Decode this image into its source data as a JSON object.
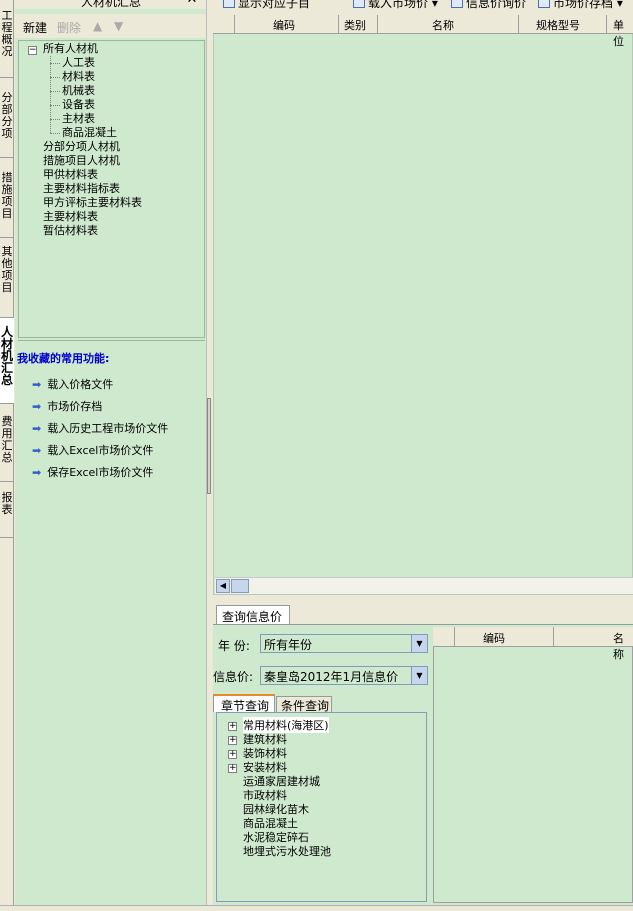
{
  "vertical_tabs": [
    {
      "label": "工程概况"
    },
    {
      "label": "分部分项"
    },
    {
      "label": "措施项目"
    },
    {
      "label": "其他项目"
    },
    {
      "label": "人材机汇总"
    },
    {
      "label": "费用汇总"
    },
    {
      "label": "报表"
    }
  ],
  "left_panel": {
    "title": "人材机汇总",
    "toolbar": {
      "new_label": "新建",
      "delete_label": "删除",
      "up_icon": "arrow-up-icon",
      "down_icon": "arrow-down-icon"
    },
    "tree": {
      "root": "所有人材机",
      "children": [
        "人工表",
        "材料表",
        "机械表",
        "设备表",
        "主材表",
        "商品混凝土"
      ],
      "others": [
        "分部分项人材机",
        "措施项目人材机",
        "甲供材料表",
        "主要材料指标表",
        "甲方评标主要材料表",
        "主要材料表",
        "暂估材料表"
      ]
    },
    "favorites": {
      "title": "我收藏的常用功能:",
      "items": [
        "载入价格文件",
        "市场价存档",
        "载入历史工程市场价文件",
        "载入Excel市场价文件",
        "保存Excel市场价文件"
      ]
    }
  },
  "toolbar": {
    "items": [
      {
        "label": "显示对应子目",
        "icon": "grid-icon"
      },
      {
        "label": "载入市场价",
        "icon": "load-icon"
      },
      {
        "label": "信息价询价",
        "icon": "info-icon"
      },
      {
        "label": "市场价存档",
        "icon": "archive-icon"
      }
    ]
  },
  "grid": {
    "columns": [
      "编码",
      "类别",
      "名称",
      "规格型号",
      "单位"
    ]
  },
  "query": {
    "tab_label": "查询信息价",
    "year_label": "年 份:",
    "year_value": "所有年份",
    "info_label": "信息价:",
    "info_value": "秦皇岛2012年1月信息价",
    "subtabs": [
      "章节查询",
      "条件查询"
    ],
    "categories": [
      {
        "label": "常用材料(海港区)",
        "expandable": true
      },
      {
        "label": "建筑材料",
        "expandable": true
      },
      {
        "label": "装饰材料",
        "expandable": true
      },
      {
        "label": "安装材料",
        "expandable": true
      },
      {
        "label": "运通家居建材城",
        "expandable": false
      },
      {
        "label": "市政材料",
        "expandable": false
      },
      {
        "label": "园林绿化苗木",
        "expandable": false
      },
      {
        "label": "商品混凝土",
        "expandable": false
      },
      {
        "label": "水泥稳定碎石",
        "expandable": false
      },
      {
        "label": "地埋式污水处理池",
        "expandable": false
      }
    ],
    "result_columns": [
      "编码",
      "名称"
    ]
  },
  "colors": {
    "panel_bg": "#cfe9cf",
    "chrome_bg": "#ece9d8",
    "favorites_title": "#0000cc",
    "tab_accent": "#e68b2c"
  }
}
